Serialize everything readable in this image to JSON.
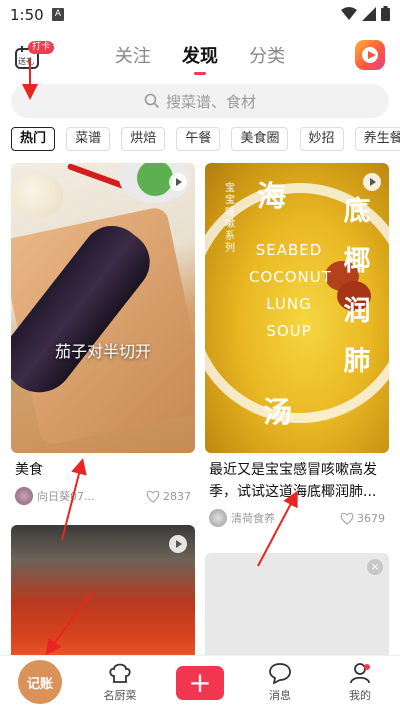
{
  "status": {
    "time": "1:50",
    "a_icon": "A"
  },
  "header": {
    "checkin_badge": "打卡",
    "checkin_label": "送礼",
    "tabs": [
      {
        "label": "关注",
        "active": false
      },
      {
        "label": "发现",
        "active": true
      },
      {
        "label": "分类",
        "active": false
      }
    ]
  },
  "search": {
    "placeholder": "搜菜谱、食材"
  },
  "chips": [
    "热门",
    "菜谱",
    "烘焙",
    "午餐",
    "美食圈",
    "妙招",
    "养生餐"
  ],
  "feed": {
    "cards": [
      {
        "overlay": "茄子对半切开",
        "title": "美食",
        "author": "向日葵07...",
        "likes": "2837"
      },
      {
        "overlay_en": [
          "SEABED",
          "COCONUT",
          "LUNG",
          "SOUP"
        ],
        "overlay_cn": [
          "底",
          "椰",
          "润",
          "肺"
        ],
        "overlay_top": "海",
        "overlay_bottom": "汤",
        "overlay_side": "宝宝咳嗽系列",
        "title": "最近又是宝宝感冒咳嗽高发季，试试这道海底椰润肺...",
        "author": "清荷食养",
        "likes": "3679"
      }
    ],
    "close_glyph": "×"
  },
  "bottom_nav": {
    "record": "记账",
    "chef": "名厨菜",
    "plus": "+",
    "messages": "消息",
    "me": "我的"
  },
  "colors": {
    "accent": "#f23b4f",
    "record_button": "#d9925a"
  }
}
